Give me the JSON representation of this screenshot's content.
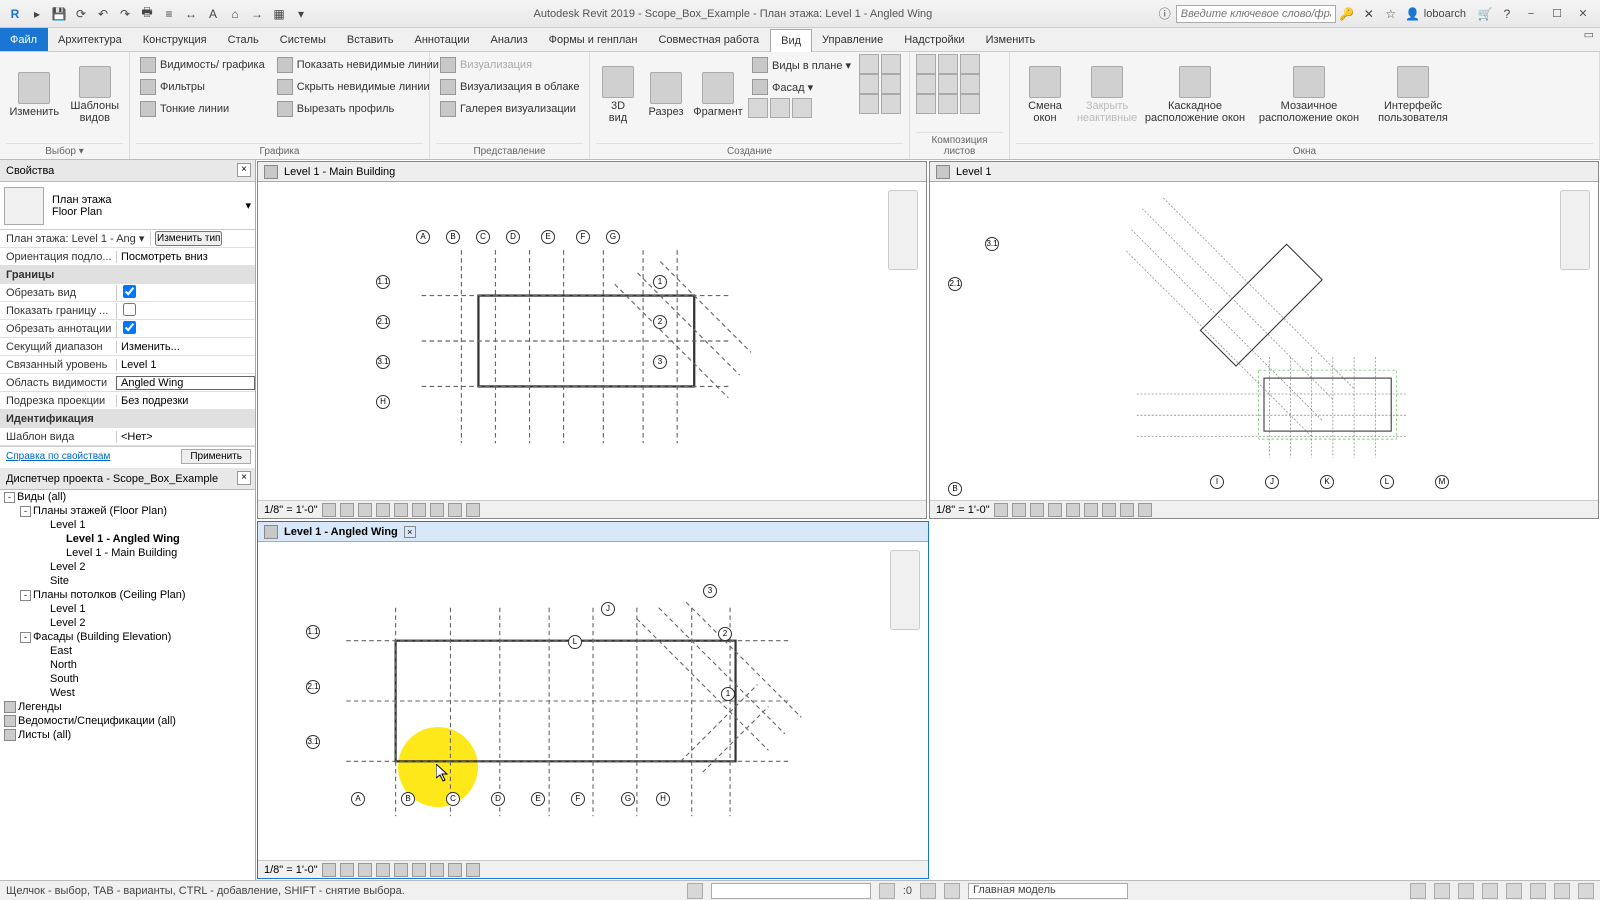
{
  "app": {
    "title": "Autodesk Revit 2019 - Scope_Box_Example - План этажа: Level 1 - Angled Wing",
    "search_placeholder": "Введите ключевое слово/фразу",
    "user": "loboarch"
  },
  "menu": {
    "file": "Файл",
    "items": [
      "Архитектура",
      "Конструкция",
      "Сталь",
      "Системы",
      "Вставить",
      "Аннотации",
      "Анализ",
      "Формы и генплан",
      "Совместная работа",
      "Вид",
      "Управление",
      "Надстройки",
      "Изменить"
    ],
    "active": "Вид"
  },
  "ribbon": {
    "select": {
      "modify": "Изменить",
      "templates": "Шаблоны\nвидов",
      "caption": "Выбор ▾"
    },
    "graphics": {
      "vis": "Видимость/ графика",
      "filters": "Фильтры",
      "thin": "Тонкие линии",
      "show_inv": "Показать невидимые линии",
      "del_inv": "Скрыть невидимые линии",
      "cut": "Вырезать профиль",
      "caption": "Графика"
    },
    "present": {
      "render": "Визуализация",
      "cloud": "Визуализация в облаке",
      "gallery": "Галерея визуализации",
      "caption": "Представление"
    },
    "create": {
      "view3d": "3D\nвид",
      "section": "Разрез",
      "fragment": "Фрагмент",
      "planviews": "Виды в плане ▾",
      "facade": "Фасад ▾",
      "caption": "Создание"
    },
    "sheets": {
      "switch": "Смена\nокон",
      "close": "Закрыть\nнеактивные",
      "cascade": "Каскадное\nрасположение окон",
      "tile": "Мозаичное\nрасположение окон",
      "ui": "Интерфейс\nпользователя",
      "caption_comp": "Композиция листов",
      "caption_win": "Окна"
    }
  },
  "props": {
    "title": "Свойства",
    "type_label": "План этажа",
    "type_name": "Floor Plan",
    "instance": "План этажа: Level 1 - Ang",
    "edit_type": "Изменить тип",
    "rows": [
      {
        "k": "Ориентация подло...",
        "v": "Посмотреть вниз"
      },
      {
        "k": "Границы",
        "section": true
      },
      {
        "k": "Обрезать вид",
        "cb": true,
        "checked": true
      },
      {
        "k": "Показать границу ...",
        "cb": true,
        "checked": false
      },
      {
        "k": "Обрезать аннотации",
        "cb": true,
        "checked": true
      },
      {
        "k": "Секущий диапазон",
        "v": "Изменить..."
      },
      {
        "k": "Связанный уровень",
        "v": "Level 1"
      },
      {
        "k": "Область видимости",
        "v": "Angled Wing",
        "hl": true
      },
      {
        "k": "Подрезка проекции",
        "v": "Без подрезки"
      },
      {
        "k": "Идентификация",
        "section": true
      },
      {
        "k": "Шаблон вида",
        "v": "<Нет>"
      }
    ],
    "help": "Справка по свойствам",
    "apply": "Применить"
  },
  "browser": {
    "title": "Диспетчер проекта - Scope_Box_Example",
    "tree": [
      {
        "t": "Виды (all)",
        "d": 0,
        "exp": "-"
      },
      {
        "t": "Планы этажей (Floor Plan)",
        "d": 1,
        "exp": "-"
      },
      {
        "t": "Level 1",
        "d": 2
      },
      {
        "t": "Level 1 - Angled Wing",
        "d": 3,
        "bold": true
      },
      {
        "t": "Level 1 - Main Building",
        "d": 3
      },
      {
        "t": "Level 2",
        "d": 2
      },
      {
        "t": "Site",
        "d": 2
      },
      {
        "t": "Планы потолков (Ceiling Plan)",
        "d": 1,
        "exp": "-"
      },
      {
        "t": "Level 1",
        "d": 2
      },
      {
        "t": "Level 2",
        "d": 2
      },
      {
        "t": "Фасады (Building Elevation)",
        "d": 1,
        "exp": "-"
      },
      {
        "t": "East",
        "d": 2
      },
      {
        "t": "North",
        "d": 2
      },
      {
        "t": "South",
        "d": 2
      },
      {
        "t": "West",
        "d": 2
      },
      {
        "t": "Легенды",
        "d": 0,
        "ico": true
      },
      {
        "t": "Ведомости/Спецификации (all)",
        "d": 0,
        "ico": true
      },
      {
        "t": "Листы (all)",
        "d": 0,
        "ico": true
      }
    ]
  },
  "views": {
    "v1": {
      "title": "Level 1 - Main Building",
      "scale": "1/8\" = 1'-0\""
    },
    "v2": {
      "title": "Level 1 - Angled Wing",
      "scale": "1/8\" = 1'-0\"",
      "active": true
    },
    "v3": {
      "title": "Level 1",
      "scale": "1/8\" = 1'-0\""
    }
  },
  "grids": {
    "letters": [
      "A",
      "B",
      "C",
      "D",
      "E",
      "F",
      "G",
      "H"
    ],
    "nums_v1": [
      "1.1",
      "2.1",
      "3.1"
    ],
    "nums_v2": [
      "1.1",
      "2.1",
      "3.1"
    ],
    "diag": [
      "1",
      "2",
      "3",
      "J",
      "K",
      "L",
      "M",
      "H",
      "G",
      "F",
      "E",
      "D",
      "C",
      "B"
    ]
  },
  "status": {
    "hint": "Щелчок - выбор, TAB - варианты, CTRL - добавление, SHIFT - снятие выбора.",
    "num": ":0",
    "model": "Главная модель"
  }
}
